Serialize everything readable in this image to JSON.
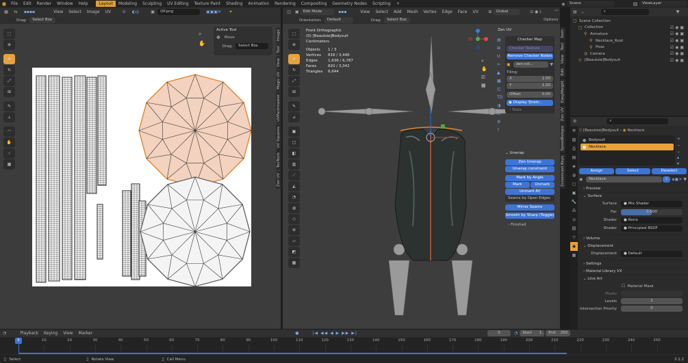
{
  "menu": {
    "items": [
      "File",
      "Edit",
      "Render",
      "Window",
      "Help"
    ],
    "workspaces": [
      "Layout",
      "Modeling",
      "Sculpting",
      "UV Editing",
      "Texture Paint",
      "Shading",
      "Animation",
      "Rendering",
      "Compositing",
      "Geometry Nodes",
      "Scripting"
    ],
    "active": "Layout",
    "scene": "Scene",
    "view_layer": "ViewLayer"
  },
  "uv": {
    "menu": [
      "View",
      "Select",
      "Image",
      "UV"
    ],
    "image_name": "OP.png",
    "drag_label": "Drag:",
    "drag_value": "Select Box",
    "active_tool": "Active Tool",
    "move": "Move",
    "tool_drag": "Drag:",
    "tool_drag_value": "Select Box",
    "vtabs": [
      "Image",
      "Tool",
      "View",
      "Magic UV",
      "UVPackmaster",
      "UV Squares",
      "TexTools",
      "Zen UV"
    ]
  },
  "vp": {
    "mode": "Edit Mode",
    "menu": [
      "View",
      "Select",
      "Add",
      "Mesh",
      "Vertex",
      "Edge",
      "Face",
      "UV"
    ],
    "transform": "Global",
    "options": "Options",
    "orientation_label": "Orientation:",
    "orientation": "Default",
    "drag_label": "Drag:",
    "drag_value": "Select Box",
    "info": {
      "view": "Front Orthographic",
      "object": "(0) [Beautsie]Bodysuit",
      "units": "Centimeters",
      "rows": [
        [
          "Objects",
          "1 / 3"
        ],
        [
          "Vertices",
          "818 / 3,446"
        ],
        [
          "Edges",
          "1,636 / 6,787"
        ],
        [
          "Faces",
          "820 / 3,342"
        ],
        [
          "Triangles",
          "6,644"
        ]
      ]
    },
    "vtabs": [
      "Item",
      "Tool",
      "View",
      "Edit",
      "EasyWeight",
      "Zen UV",
      "SpeedRetopo",
      "Screencast Keys"
    ]
  },
  "zen": {
    "title": "Zen UV",
    "checker_title": "Checker Map",
    "checker_texture": "Checker Texture",
    "remove_nodes": "Remove Checker Nodes",
    "image": "zen-col...",
    "tiling": "Tiling:",
    "x_label": "X",
    "x_val": "1.00",
    "y_label": "Y",
    "y_val": "1.00",
    "offset_label": "Offset",
    "offset_val": "0.00",
    "display_stretch": "Display Stretc...",
    "tools": "Tools",
    "unwrap_title": "Unwrap",
    "zen_unwrap": "Zen Unwrap",
    "unwrap_constraint": "Unwrap constraint",
    "mark_by_angle": "Mark by Angle",
    "mark": "Mark",
    "unmark": "Unmark",
    "unmark_all": "Unmark All",
    "seams_open_edges": "Seams by Open Edges",
    "mirror_seams": "Mirror Seams",
    "smooth_sharp": "Smooth by Sharp (Toggle)",
    "finished": "Finished"
  },
  "outliner": {
    "items": [
      {
        "name": "Scene Collection",
        "indent": 0
      },
      {
        "name": "Collection",
        "indent": 1
      },
      {
        "name": "Armature",
        "indent": 2
      },
      {
        "name": "Necklace_Root",
        "indent": 3
      },
      {
        "name": "Pose",
        "indent": 3
      },
      {
        "name": "Camera",
        "indent": 2
      },
      {
        "name": "[Beautsie]Bodysuit",
        "indent": 1
      }
    ]
  },
  "props": {
    "breadcrumb_obj": "[Beautsie]Bodysuit",
    "breadcrumb_mat": "Necklace",
    "slots": [
      "Bodysuit",
      "Necklace"
    ],
    "selected_slot": "Necklace",
    "assign": "Assign",
    "select": "Select",
    "deselect": "Deselect",
    "material_name": "Necklace",
    "users": "2",
    "preview": "Preview",
    "surface": "Surface",
    "surface_label": "Surface",
    "surface_val": "Mix Shader",
    "fac_label": "Fac",
    "fac_val": "0.500",
    "shader1_label": "Shader",
    "shader1_val": "None",
    "shader2_label": "Shader",
    "shader2_val": "Principled BSDF",
    "volume": "Volume",
    "displacement": "Displacement",
    "displacement_label": "Displacement",
    "displacement_val": "Default",
    "settings": "Settings",
    "material_library": "Material Library VX",
    "line_art": "Line Art",
    "material_mask": "Material Mask",
    "masks": "Masks",
    "levels": "Levels",
    "levels_val": "1",
    "intersection_priority": "Intersection Priority",
    "intersection_val": "0"
  },
  "timeline": {
    "menu": [
      "Playback",
      "Keying",
      "View",
      "Marker"
    ],
    "current": "0",
    "start_label": "Start",
    "start": "1",
    "end_label": "End",
    "end": "250",
    "ticks": [
      "0",
      "10",
      "20",
      "30",
      "40",
      "50",
      "60",
      "70",
      "80",
      "90",
      "100",
      "110",
      "120",
      "130",
      "140",
      "150",
      "160",
      "170",
      "180",
      "190",
      "200",
      "210",
      "220",
      "230",
      "240",
      "250"
    ]
  },
  "status": {
    "select": "Select",
    "rotate": "Rotate View",
    "call_menu": "Call Menu",
    "version": "3.1.2"
  },
  "colors": {
    "accent": "#e7a23a",
    "blue": "#3d74d6",
    "orange_fill": "#f3d2bf",
    "orange_edge": "#e0862a"
  }
}
